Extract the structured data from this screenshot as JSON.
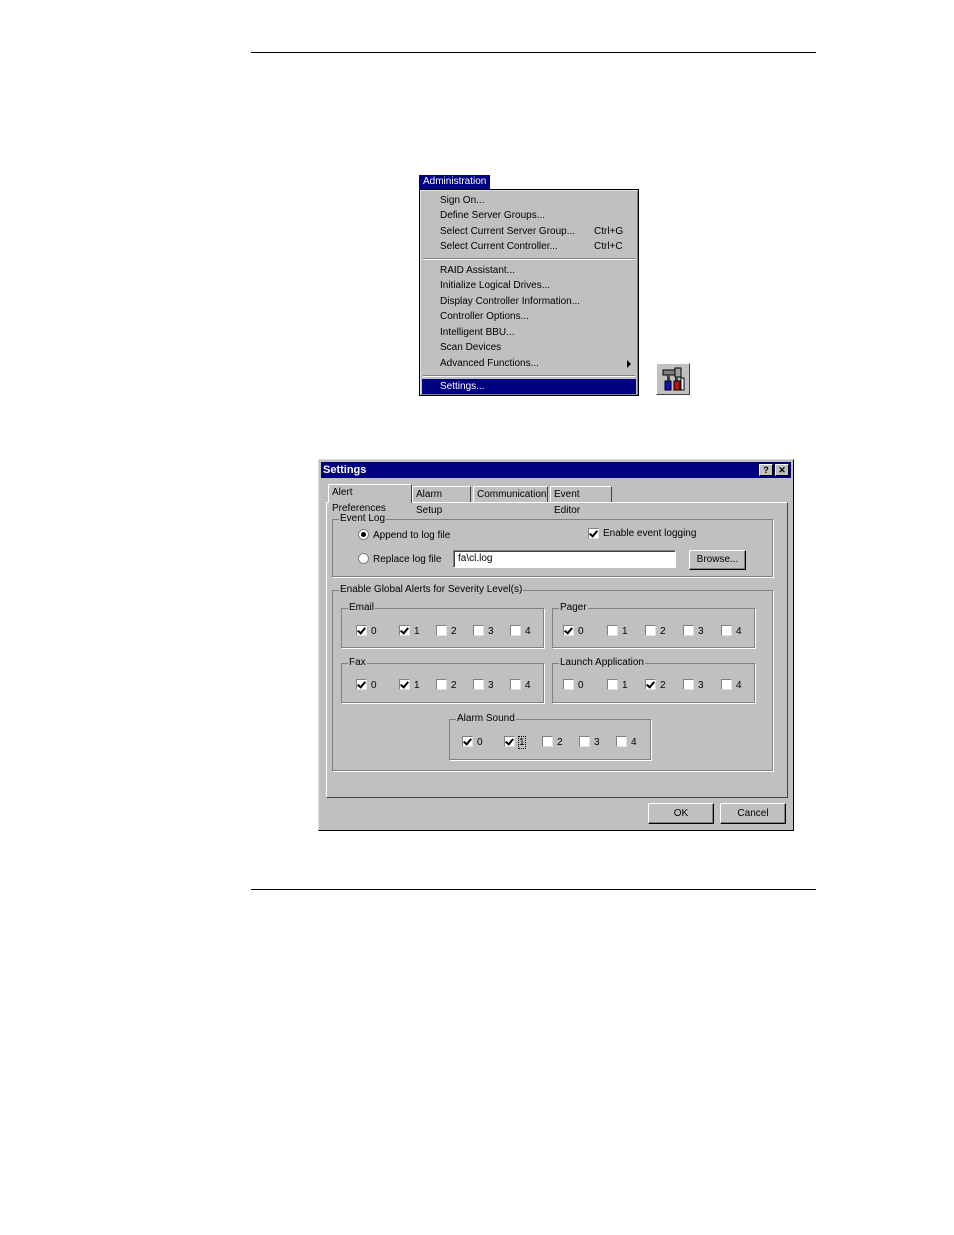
{
  "admin_menu": {
    "title": "Administration",
    "items": [
      {
        "label": "Sign On...",
        "shortcut": ""
      },
      {
        "label": "Define Server Groups...",
        "shortcut": ""
      },
      {
        "label": "Select Current Server Group...",
        "shortcut": "Ctrl+G"
      },
      {
        "label": "Select Current Controller...",
        "shortcut": "Ctrl+C"
      },
      {
        "label": "RAID Assistant...",
        "shortcut": ""
      },
      {
        "label": "Initialize Logical Drives...",
        "shortcut": ""
      },
      {
        "label": "Display Controller Information...",
        "shortcut": ""
      },
      {
        "label": "Controller Options...",
        "shortcut": ""
      },
      {
        "label": "Intelligent BBU...",
        "shortcut": ""
      },
      {
        "label": "Scan Devices",
        "shortcut": ""
      },
      {
        "label": "Advanced Functions...",
        "shortcut": "",
        "submenu": true
      },
      {
        "label": "Settings...",
        "shortcut": "",
        "selected": true
      }
    ]
  },
  "toolbar_icon": "settings-tools-icon",
  "dialog": {
    "title": "Settings",
    "help_button": "?",
    "close_button": "✕",
    "tabs": [
      {
        "label": "Alert Preferences",
        "active": true
      },
      {
        "label": "Alarm Setup",
        "active": false
      },
      {
        "label": "Communication",
        "active": false
      },
      {
        "label": "Event Editor",
        "active": false
      }
    ],
    "event_log": {
      "label": "Event Log",
      "append_label": "Append to log file",
      "replace_label": "Replace log file",
      "selected": "append",
      "enable_logging_label": "Enable event logging",
      "enable_logging_checked": true,
      "log_file_value": "fa\\cl.log",
      "browse_label": "Browse..."
    },
    "global_alerts": {
      "label": "Enable Global Alerts for Severity Level(s)",
      "groups": {
        "email": {
          "label": "Email",
          "levels": [
            "0",
            "1",
            "2",
            "3",
            "4"
          ],
          "checked": [
            true,
            true,
            false,
            false,
            false
          ]
        },
        "pager": {
          "label": "Pager",
          "levels": [
            "0",
            "1",
            "2",
            "3",
            "4"
          ],
          "checked": [
            true,
            false,
            false,
            false,
            false
          ]
        },
        "fax": {
          "label": "Fax",
          "levels": [
            "0",
            "1",
            "2",
            "3",
            "4"
          ],
          "checked": [
            true,
            true,
            false,
            false,
            false
          ]
        },
        "launch": {
          "label": "Launch Application",
          "levels": [
            "0",
            "1",
            "2",
            "3",
            "4"
          ],
          "checked": [
            false,
            false,
            true,
            false,
            false
          ]
        },
        "alarm": {
          "label": "Alarm Sound",
          "levels": [
            "0",
            "1",
            "2",
            "3",
            "4"
          ],
          "checked": [
            true,
            true,
            false,
            false,
            false
          ]
        }
      }
    },
    "ok_label": "OK",
    "cancel_label": "Cancel"
  }
}
